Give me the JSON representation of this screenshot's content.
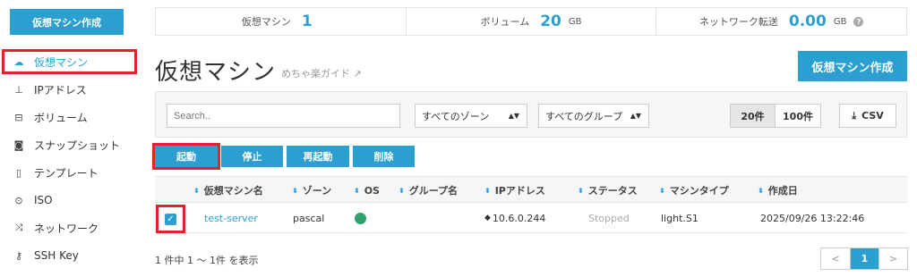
{
  "sidebar": {
    "create_label": "仮想マシン作成",
    "items": [
      {
        "label": "仮想マシン",
        "icon": "cloud-icon"
      },
      {
        "label": "IPアドレス",
        "icon": "sitemap-icon"
      },
      {
        "label": "ボリューム",
        "icon": "drive-icon"
      },
      {
        "label": "スナップショット",
        "icon": "camera-icon"
      },
      {
        "label": "テンプレート",
        "icon": "file-icon"
      },
      {
        "label": "ISO",
        "icon": "disc-icon"
      },
      {
        "label": "ネットワーク",
        "icon": "shuffle-icon"
      },
      {
        "label": "SSH Key",
        "icon": "key-icon"
      }
    ]
  },
  "stats": {
    "vm_label": "仮想マシン",
    "vm_count": "1",
    "volume_label": "ボリューム",
    "volume_value": "20",
    "volume_unit": "GB",
    "transfer_label": "ネットワーク転送",
    "transfer_value": "0.00",
    "transfer_unit": "GB"
  },
  "header": {
    "title": "仮想マシン",
    "guide": "めちゃ楽ガイド",
    "create_label": "仮想マシン作成"
  },
  "filters": {
    "search_placeholder": "Search..",
    "zone": "すべてのゾーン",
    "group": "すべてのグループ",
    "page_20": "20件",
    "page_100": "100件",
    "csv": "CSV"
  },
  "actions": {
    "start": "起動",
    "stop": "停止",
    "restart": "再起動",
    "delete": "削除"
  },
  "table": {
    "headers": [
      "仮想マシン名",
      "ゾーン",
      "OS",
      "グループ名",
      "IPアドレス",
      "ステータス",
      "マシンタイプ",
      "作成日"
    ],
    "rows": [
      {
        "name": "test-server",
        "zone": "pascal",
        "group": "",
        "ip": "10.6.0.244",
        "status": "Stopped",
        "type": "light.S1",
        "created": "2025/09/26 13:22:46"
      }
    ]
  },
  "footer": {
    "summary": "1 件中 1 ～ 1件 を表示",
    "prev": "<",
    "page": "1",
    "next": ">"
  },
  "colors": {
    "accent": "#2a9fd0",
    "highlight": "#e3232c",
    "os": "#2fa36b"
  }
}
